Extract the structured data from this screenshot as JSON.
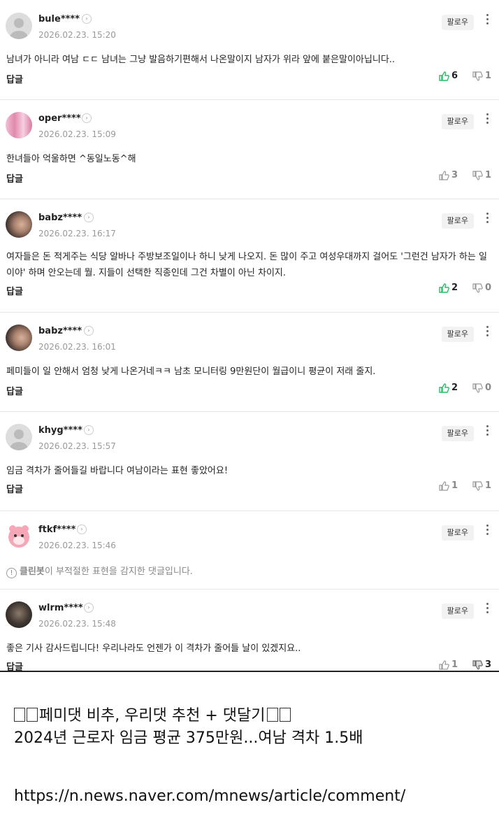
{
  "comments": [
    {
      "user": "bule****",
      "date": "2026.02.23. 15:20",
      "follow": "팔로우",
      "text": "남녀가 아니라 여남 ㄷㄷ 남녀는 그냥 발음하기편해서 나온말이지 남자가 위라 앞에 붙은말이아닙니다..",
      "reply": "답글",
      "likes": "6",
      "dislikes": "1",
      "liked": true
    },
    {
      "user": "oper****",
      "date": "2026.02.23. 15:09",
      "follow": "팔로우",
      "text": "한녀들아 억울하면 ^동일노동^해",
      "reply": "답글",
      "likes": "3",
      "dislikes": "1",
      "liked": false
    },
    {
      "user": "babz****",
      "date": "2026.02.23. 16:17",
      "follow": "팔로우",
      "text": "여자들은 돈 적게주는 식당 알바나 주방보조일이나 하니 낮게 나오지. 돈 많이 주고 여성우대까지 걸어도 '그런건 남자가 하는 일이야' 하며 안오는데 뭘. 지들이 선택한 직종인데 그건 차별이 아닌 차이지.",
      "reply": "답글",
      "likes": "2",
      "dislikes": "0",
      "liked": true
    },
    {
      "user": "babz****",
      "date": "2026.02.23. 16:01",
      "follow": "팔로우",
      "text": "페미들이 일 안해서 엄청 낮게 나온거네ㅋㅋ 남초 모니터링 9만원단이 월급이니 평균이 저래 줄지.",
      "reply": "답글",
      "likes": "2",
      "dislikes": "0",
      "liked": true
    },
    {
      "user": "khyg****",
      "date": "2026.02.23. 15:57",
      "follow": "팔로우",
      "text": "임금 격차가 줄어들길 바랍니다 여남이라는 표현 좋았어요!",
      "reply": "답글",
      "likes": "1",
      "dislikes": "1",
      "liked": false
    },
    {
      "user": "ftkf****",
      "date": "2026.02.23. 15:46",
      "follow": "팔로우",
      "warn_bold": "클린봇",
      "warn_rest": "이 부적절한 표현을 감지한 댓글입니다."
    },
    {
      "user": "wlrm****",
      "date": "2026.02.23. 15:48",
      "follow": "팔로우",
      "text": "좋은 기사 감사드립니다! 우리나라도 언젠가 이 격차가 줄어들 날이 있겠지요..",
      "reply": "답글",
      "likes": "1",
      "dislikes": "3",
      "liked": false
    }
  ],
  "caption": {
    "line1": "페미댓 비추, 우리댓 추천 + 댓달기",
    "line2": "2024년 근로자 임금 평균 375만원...여남 격차 1.5배",
    "url": "https://n.news.naver.com/mnews/article/comment/"
  }
}
